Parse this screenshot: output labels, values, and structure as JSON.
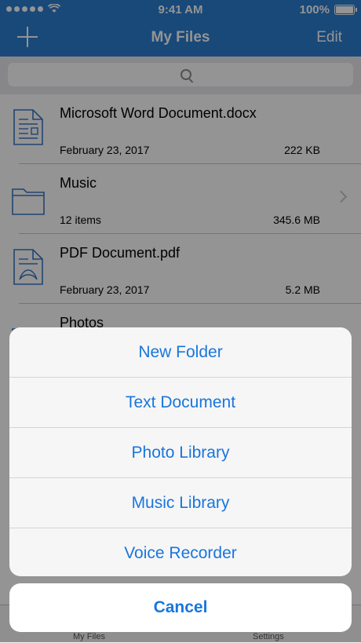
{
  "status_bar": {
    "time": "9:41 AM",
    "battery": "100%"
  },
  "nav": {
    "title": "My Files",
    "edit_label": "Edit"
  },
  "files": [
    {
      "name": "Microsoft Word Document.docx",
      "date": "February 23, 2017",
      "size": "222 KB",
      "icon": "word-document-icon"
    },
    {
      "name": "Music",
      "date": "12 items",
      "size": "345.6 MB",
      "icon": "folder-icon"
    },
    {
      "name": "PDF Document.pdf",
      "date": "February 23, 2017",
      "size": "5.2 MB",
      "icon": "pdf-document-icon"
    },
    {
      "name": "Photos",
      "icon": "folder-icon"
    }
  ],
  "tabs": [
    {
      "label": "My Files"
    },
    {
      "label": "Settings"
    }
  ],
  "action_sheet": {
    "actions": [
      "New Folder",
      "Text Document",
      "Photo Library",
      "Music Library",
      "Voice Recorder"
    ],
    "cancel_label": "Cancel"
  },
  "colors": {
    "nav_blue": "#2a7ed1",
    "action_blue": "#1876de",
    "icon_blue": "#3b78c4"
  }
}
